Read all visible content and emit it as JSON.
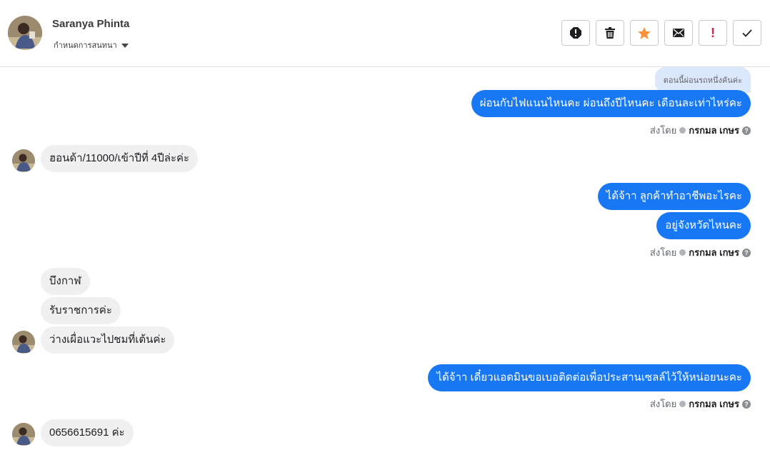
{
  "header": {
    "contact_name": "Saranya Phinta",
    "conversation_settings": "กำหนดการสนทนา"
  },
  "toolbar": {
    "buttons": [
      {
        "name": "report-icon"
      },
      {
        "name": "trash-icon"
      },
      {
        "name": "star-icon",
        "color": "#f7923a"
      },
      {
        "name": "envelope-icon"
      },
      {
        "name": "important-icon",
        "label": "!",
        "color": "#e41e3f"
      },
      {
        "name": "checkmark-icon"
      }
    ]
  },
  "colors": {
    "accent": "#1877f2",
    "incoming_bubble": "#f0f0f0",
    "quoted_bubble": "#dbe8fb"
  },
  "thread": {
    "quoted_reply": "ตอนนี้ผ่อนรถหนึ่งคันค่ะ",
    "sent_by_label": "ส่งโดย",
    "agent_name": "กรกมล เกษร",
    "messages": [
      {
        "dir": "out",
        "text": "ผ่อนกับไฟแนนไหนคะ ผ่อนถึงปีไหนคะ เดือนละเท่าไหร่คะ"
      },
      {
        "dir": "in",
        "text": "ฮอนด้า/11000/เข้าปีที่ 4ปีล่ะค่ะ"
      },
      {
        "dir": "out",
        "text": "ได้จ้าา ลูกค้าทำอาชีพอะไรคะ"
      },
      {
        "dir": "out",
        "text": "อยู่จังหวัดไหนคะ"
      },
      {
        "dir": "in",
        "text": "บึงกาฬ"
      },
      {
        "dir": "in",
        "text": "รับราชการค่ะ"
      },
      {
        "dir": "in",
        "text": "ว่างเผื่อแวะไปชมที่เต้นค่ะ"
      },
      {
        "dir": "out",
        "text": "ได้จ้าา เดี๋ยวแอดมินขอเบอติดต่อเพื่อประสานเซลล์ไว้ให้หน่อยนะคะ"
      },
      {
        "dir": "in",
        "text": "0656615691 ค่ะ"
      }
    ]
  }
}
